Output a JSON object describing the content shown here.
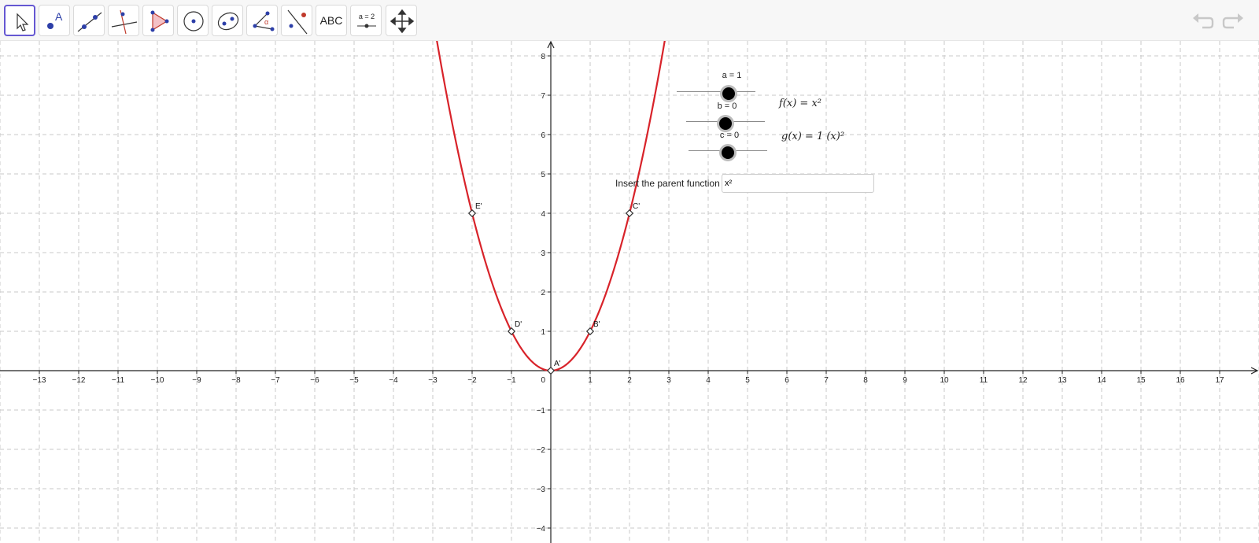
{
  "toolbar": {
    "tools": [
      {
        "name": "move-tool",
        "icon": "pointer-icon"
      },
      {
        "name": "point-tool",
        "icon": "point-icon"
      },
      {
        "name": "line-tool",
        "icon": "line-icon"
      },
      {
        "name": "perpendicular-tool",
        "icon": "perpendicular-icon"
      },
      {
        "name": "polygon-tool",
        "icon": "polygon-icon"
      },
      {
        "name": "circle-tool",
        "icon": "circle-icon"
      },
      {
        "name": "ellipse-tool",
        "icon": "ellipse-icon"
      },
      {
        "name": "angle-tool",
        "icon": "angle-icon"
      },
      {
        "name": "reflect-tool",
        "icon": "reflect-icon"
      },
      {
        "name": "text-tool",
        "icon": "text-icon",
        "label": "ABC"
      },
      {
        "name": "slider-tool",
        "icon": "slider-icon",
        "label": "a = 2"
      },
      {
        "name": "move-graphics-tool",
        "icon": "move-graphics-icon"
      }
    ],
    "undo_icon": "undo-icon",
    "redo_icon": "redo-icon"
  },
  "sliders": [
    {
      "label": "a = 1",
      "name": "a",
      "value": 1
    },
    {
      "label": "b = 0",
      "name": "b",
      "value": 0
    },
    {
      "label": "c = 0",
      "name": "c",
      "value": 0
    }
  ],
  "functions": {
    "f": "f(x) = x²",
    "g": "g(x) = 1 (x)²"
  },
  "input": {
    "label": "Insert the parent function",
    "value": "x²"
  },
  "graph": {
    "x_range": [
      -14,
      18
    ],
    "y_range": [
      -4.3,
      8.3
    ],
    "x_ticks": [
      -13,
      -12,
      -11,
      -10,
      -9,
      -8,
      -7,
      -6,
      -5,
      -4,
      -3,
      -2,
      -1,
      1,
      2,
      3,
      4,
      5,
      6,
      7,
      8,
      9,
      10,
      11,
      12,
      13,
      14,
      15,
      16,
      17
    ],
    "y_ticks": [
      -4,
      -3,
      -2,
      -1,
      1,
      2,
      3,
      4,
      5,
      6,
      7,
      8
    ],
    "origin_label": "0",
    "curve_color": "#d8232a",
    "points": [
      {
        "label": "A'",
        "x": 0,
        "y": 0
      },
      {
        "label": "B'",
        "x": 1,
        "y": 1
      },
      {
        "label": "C'",
        "x": 2,
        "y": 4
      },
      {
        "label": "D'",
        "x": -1,
        "y": 1
      },
      {
        "label": "E'",
        "x": -2,
        "y": 4
      }
    ]
  }
}
